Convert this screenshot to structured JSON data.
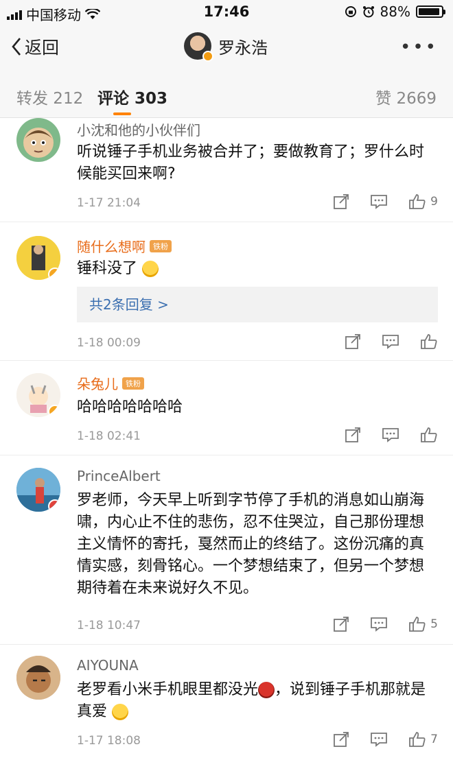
{
  "status_bar": {
    "carrier": "中国移动",
    "time": "17:46",
    "battery": "88%",
    "battery_level": 0.88
  },
  "nav": {
    "back_label": "返回",
    "title": "罗永浩"
  },
  "tabs": {
    "repost": "转发 212",
    "comments": "评论 303",
    "likes": "赞 2669"
  },
  "comments": [
    {
      "user": "小沈和他的小伙伴们",
      "text": "听说锤子手机业务被合并了；要做教育了；罗什么时候能买回来啊?",
      "time": "1-17 21:04",
      "likes": "9"
    },
    {
      "user": "随什么想啊",
      "badge": "铁粉",
      "text": "锤科没了",
      "reply": "共2条回复 >",
      "time": "1-18 00:09",
      "likes": ""
    },
    {
      "user": "朵兔儿",
      "badge": "铁粉",
      "text": "哈哈哈哈哈哈哈",
      "time": "1-18 02:41",
      "likes": ""
    },
    {
      "user": "PrinceAlbert",
      "text": "罗老师，今天早上听到字节停了手机的消息如山崩海啸，内心止不住的悲伤，忍不住哭泣，自己那份理想主义情怀的寄托，戛然而止的终结了。这份沉痛的真情实感，刻骨铭心。一个梦想结束了，但另一个梦想期待着在未来说好久不见。",
      "time": "1-18 10:47",
      "likes": "5"
    },
    {
      "user": "AIYOUNA",
      "text_a": "老罗看小米手机眼里都没光",
      "text_b": "，说到锤子手机那就是真爱",
      "time": "1-17 18:08",
      "likes": "7"
    }
  ],
  "colors": {
    "accent": "#ff8200",
    "link": "#3b6fb0",
    "vip_name": "#e86c1a"
  }
}
